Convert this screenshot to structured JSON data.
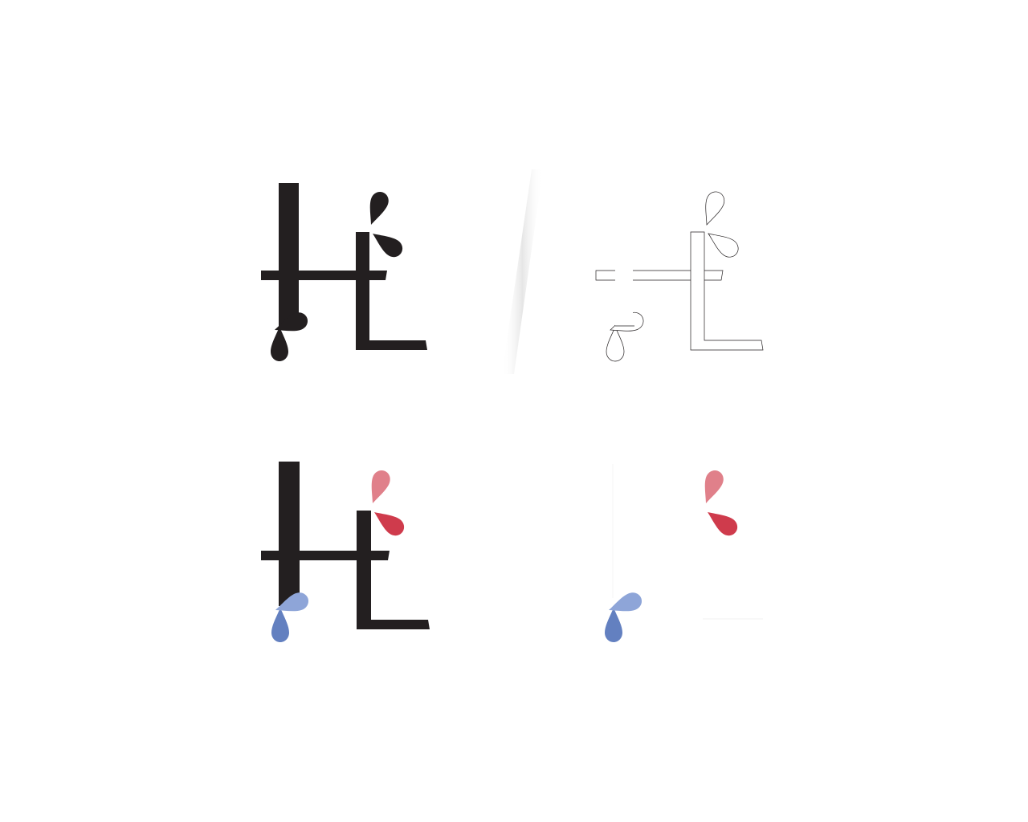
{
  "logo_sheet": {
    "variants": [
      {
        "id": "black-solid",
        "label": ""
      },
      {
        "id": "outline",
        "label": ""
      },
      {
        "id": "color-on-white",
        "label": ""
      },
      {
        "id": "color-drops-only",
        "label": ""
      }
    ]
  },
  "colors": {
    "background": "#ffffff",
    "ink": "#231f20",
    "divider_shadow": "#eeeeee",
    "outline_stroke": "#231f20",
    "red_light": "#e0808a",
    "red": "#cf3b4c",
    "blue_light": "#8ea5d8",
    "blue": "#6380c0"
  },
  "icons": {
    "drop": "teardrop-shape",
    "monogram": "hl-monogram"
  }
}
